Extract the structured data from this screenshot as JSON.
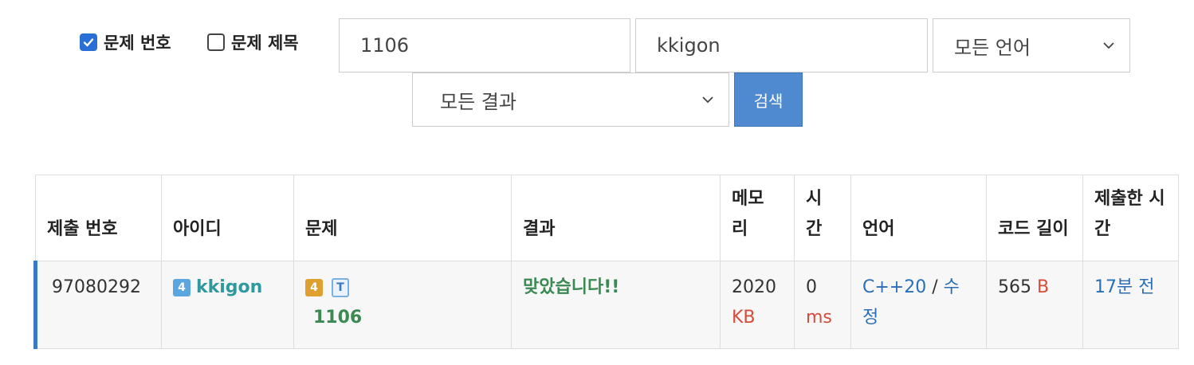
{
  "filters": {
    "problem_number_label": "문제 번호",
    "problem_number_checked": true,
    "problem_title_label": "문제 제목",
    "problem_title_checked": false,
    "problem_value": "1106",
    "user_value": "kkigon",
    "language_select": "모든 언어",
    "result_select": "모든 결과",
    "search_button": "검색"
  },
  "table": {
    "headers": {
      "submission": "제출 번호",
      "id": "아이디",
      "problem": "문제",
      "result": "결과",
      "memory": "메모리",
      "time": "시간",
      "language": "언어",
      "code_length": "코드 길이",
      "submitted_at": "제출한 시간"
    },
    "rows": [
      {
        "submission": "97080292",
        "user_tier": "4",
        "user": "kkigon",
        "problem_tier": "4",
        "problem_tag": "T",
        "problem": "1106",
        "result": "맞았습니다!!",
        "memory_value": "2020",
        "memory_unit": "KB",
        "time_value": "0",
        "time_unit": "ms",
        "language": "C++20",
        "sep": "/",
        "edit": "수정",
        "code_value": "565",
        "code_unit": "B",
        "submitted_at": "17분 전"
      }
    ]
  },
  "colors": {
    "accent": "#4f8ad1",
    "success": "#3a8a52",
    "unit": "#d64b3a",
    "link": "#2a6fb5"
  }
}
